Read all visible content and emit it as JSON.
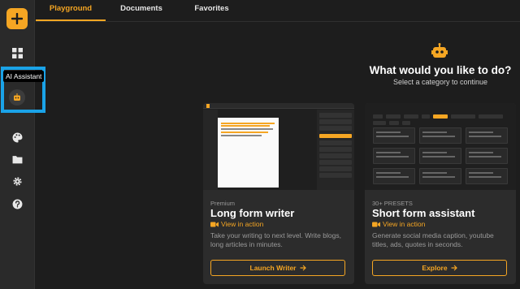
{
  "sidebar": {
    "add_icon": "plus-icon",
    "items": [
      {
        "name": "dashboard",
        "icon": "grid-icon"
      },
      {
        "name": "ai-assistant",
        "icon": "robot-icon",
        "tooltip": "AI Assistant"
      },
      {
        "name": "themes",
        "icon": "palette-icon"
      },
      {
        "name": "files",
        "icon": "folder-icon"
      },
      {
        "name": "settings",
        "icon": "gear-icon"
      },
      {
        "name": "help",
        "icon": "question-icon"
      }
    ]
  },
  "tabs": [
    {
      "label": "Playground",
      "active": true
    },
    {
      "label": "Documents",
      "active": false
    },
    {
      "label": "Favorites",
      "active": false
    }
  ],
  "main": {
    "icon": "robot-icon",
    "heading": "What would you like to do?",
    "subheading": "Select a category to continue"
  },
  "cards": [
    {
      "tag": "Premium",
      "title": "Long form writer",
      "view_label": "View in action",
      "description": "Take your writing to next level. Write blogs, long articles in minutes.",
      "button": "Launch Writer"
    },
    {
      "tag": "30+ PRESETS",
      "title": "Short form assistant",
      "view_label": "View in action",
      "description": "Generate social media caption, youtube titles, ads, quotes in seconds.",
      "button": "Explore"
    }
  ],
  "colors": {
    "accent": "#f5a623",
    "highlight": "#1aa3e8",
    "background": "#1d1d1d",
    "card": "#2c2c2c"
  }
}
